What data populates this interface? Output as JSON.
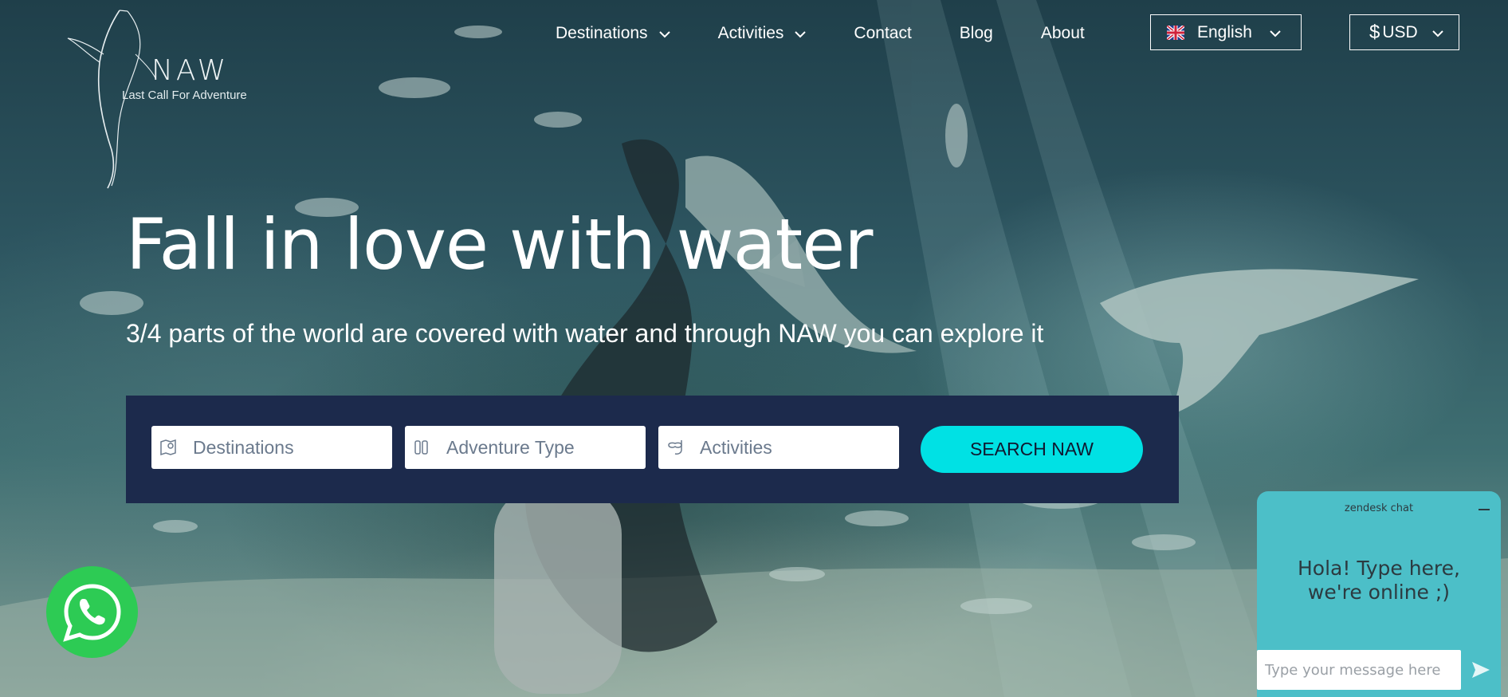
{
  "brand": {
    "name": "NAW",
    "tagline": "Last Call For Adventure"
  },
  "nav": {
    "items": [
      {
        "label": "Destinations",
        "dropdown": true
      },
      {
        "label": "Activities",
        "dropdown": true
      },
      {
        "label": "Contact",
        "dropdown": false
      },
      {
        "label": "Blog",
        "dropdown": false
      },
      {
        "label": "About",
        "dropdown": false
      }
    ],
    "language": {
      "selected": "English",
      "icon": "uk-flag-icon"
    },
    "currency": {
      "symbol": "$",
      "selected": "USD"
    }
  },
  "hero": {
    "title": "Fall in love with water",
    "subtitle": "3/4 parts of the world are covered with water and through NAW you can explore it"
  },
  "search": {
    "fields": [
      {
        "placeholder": "Destinations",
        "icon": "map-pin-icon"
      },
      {
        "placeholder": "Adventure Type",
        "icon": "equipment-icon"
      },
      {
        "placeholder": "Activities",
        "icon": "snorkel-icon"
      }
    ],
    "button_label": "SEARCH NAW"
  },
  "whatsapp": {
    "icon": "whatsapp-icon"
  },
  "chat": {
    "header": "zendesk chat",
    "greeting_line1": "Hola! Type here,",
    "greeting_line2": "we're online ;)",
    "input_placeholder": "Type your message here"
  },
  "colors": {
    "search_panel": "#1c2a4c",
    "search_button": "#00e1e4",
    "whatsapp": "#2dcb54",
    "chat": "#4cbfc8"
  }
}
